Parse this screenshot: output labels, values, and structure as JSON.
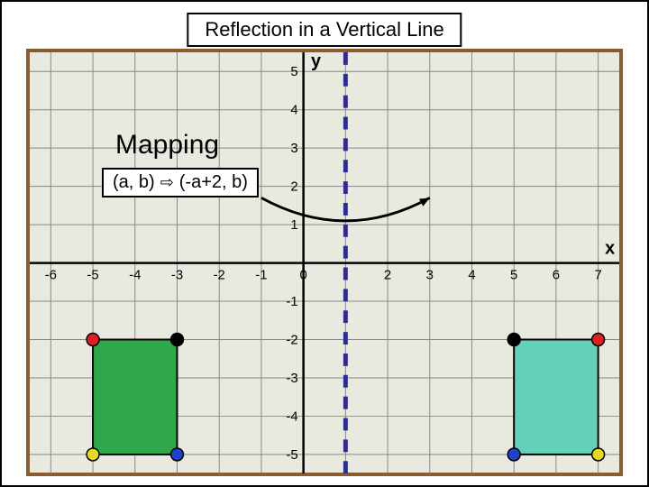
{
  "title": "Reflection in a Vertical Line",
  "mapping_heading": "Mapping",
  "mapping_rule_lhs": "(a, b)",
  "mapping_rule_arrow": "⇨",
  "mapping_rule_rhs": "(-a+2, b)",
  "axis_labels": {
    "x": "x",
    "y": "y"
  },
  "reflect_line_x": 1,
  "ticks_x": [
    -6,
    -5,
    -4,
    -3,
    -2,
    -1,
    0,
    2,
    3,
    4,
    5,
    6,
    7
  ],
  "ticks_y": [
    5,
    4,
    3,
    2,
    1,
    -1,
    -2,
    -3,
    -4,
    -5
  ],
  "chart_data": {
    "type": "scatter",
    "title": "Reflection in a Vertical Line",
    "xlabel": "x",
    "ylabel": "y",
    "xlim": [
      -6.5,
      7.5
    ],
    "ylim": [
      -5.5,
      5.5
    ],
    "grid": true,
    "reflect_line": "x = 1",
    "series": [
      {
        "name": "preimage_corners",
        "points": [
          {
            "x": -5,
            "y": -2,
            "color": "#e02020"
          },
          {
            "x": -3,
            "y": -2,
            "color": "#000000"
          },
          {
            "x": -5,
            "y": -5,
            "color": "#e8d820"
          },
          {
            "x": -3,
            "y": -5,
            "color": "#2040d0"
          }
        ],
        "fill": "#2fa84a"
      },
      {
        "name": "image_corners",
        "points": [
          {
            "x": 7,
            "y": -2,
            "color": "#e02020"
          },
          {
            "x": 5,
            "y": -2,
            "color": "#000000"
          },
          {
            "x": 7,
            "y": -5,
            "color": "#e8d820"
          },
          {
            "x": 5,
            "y": -5,
            "color": "#2040d0"
          }
        ],
        "fill": "#63d0b8"
      }
    ],
    "annotations": [
      {
        "type": "curved_arrow",
        "from": [
          -1,
          1.7
        ],
        "to": [
          3,
          1.7
        ],
        "apex_y": 1.2
      }
    ]
  }
}
